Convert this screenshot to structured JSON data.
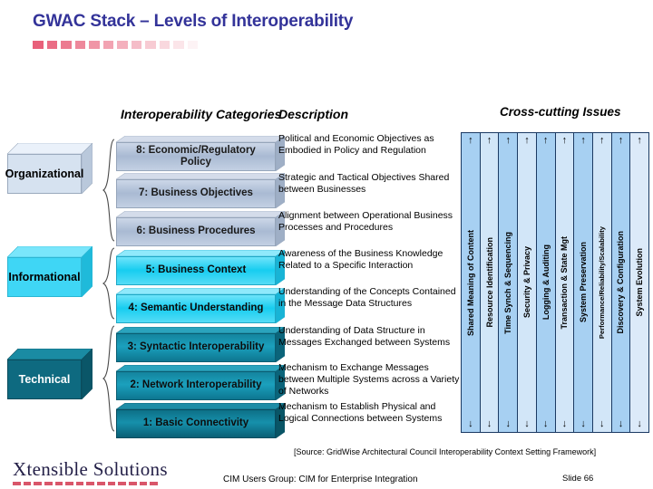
{
  "title": "GWAC Stack – Levels of Interoperability",
  "headers": {
    "categories": "Interoperability Categories",
    "description": "Description",
    "cross_cutting": "Cross-cutting Issues"
  },
  "groups": [
    {
      "label": "Organizational",
      "color": "#d6e2f0",
      "text_color": "#000000"
    },
    {
      "label": "Informational",
      "color": "#3fd6f5",
      "text_color": "#000000"
    },
    {
      "label": "Technical",
      "color": "#0e6a80",
      "text_color": "#ffffff"
    }
  ],
  "levels": [
    {
      "label": "8: Economic/Regulatory Policy",
      "description": "Political and Economic Objectives as Embodied in Policy and Regulation",
      "color": "#b8c6dc",
      "text_color": "#1a1a1a"
    },
    {
      "label": "7: Business Objectives",
      "description": "Strategic and Tactical Objectives Shared between Businesses",
      "color": "#b8c6dc",
      "text_color": "#1a1a1a"
    },
    {
      "label": "6: Business Procedures",
      "description": "Alignment between Operational Business Processes and Procedures",
      "color": "#b8c6dc",
      "text_color": "#1a1a1a"
    },
    {
      "label": "5: Business Context",
      "description": "Awareness of the Business Knowledge Related to a Specific Interaction",
      "color": "#2fd2f2",
      "text_color": "#0a0a0a"
    },
    {
      "label": "4: Semantic Understanding",
      "description": "Understanding of the Concepts Contained in the Message Data Structures",
      "color": "#2fd2f2",
      "text_color": "#0a0a0a"
    },
    {
      "label": "3: Syntactic Interoperability",
      "description": "Understanding of Data Structure in Messages Exchanged between Systems",
      "color": "#0f7f96",
      "text_color": "#0d0d0d"
    },
    {
      "label": "2: Network Interoperability",
      "description": "Mechanism to Exchange Messages between Multiple Systems across a Variety of Networks",
      "color": "#0f7f96",
      "text_color": "#0d0d0d"
    },
    {
      "label": "1: Basic Connectivity",
      "description": "Mechanism to Establish Physical and Logical Connections between Systems",
      "color": "#0a6378",
      "text_color": "#0d0d0d"
    }
  ],
  "cross_cutting_issues": [
    {
      "label": "Shared Meaning of Content",
      "color": "#a7d0f2"
    },
    {
      "label": "Resource Identification",
      "color": "#d2e6f8"
    },
    {
      "label": "Time Synch & Sequencing",
      "color": "#a7d0f2"
    },
    {
      "label": "Security & Privacy",
      "color": "#d2e6f8"
    },
    {
      "label": "Logging & Auditing",
      "color": "#a7d0f2"
    },
    {
      "label": "Transaction & State Mgt",
      "color": "#d2e6f8"
    },
    {
      "label": "System Preservation",
      "color": "#a7d0f2"
    },
    {
      "label": "Performance/Reliability/Scalability",
      "color": "#d2e6f8"
    },
    {
      "label": "Discovery & Configuration",
      "color": "#a7d0f2"
    },
    {
      "label": "System Evolution",
      "color": "#dceaf9"
    }
  ],
  "arrows": {
    "up": "↑",
    "down": "↓"
  },
  "footer": {
    "source": "[Source: GridWise Architectural Council Interoperability Context Setting Framework]",
    "center": "CIM Users Group: CIM for Enterprise Integration",
    "slide_number": "Slide 66",
    "logo_text": "Xtensible Solutions"
  },
  "theme": {
    "title_color": "#333399",
    "rule_color": "#e8607a",
    "panel_border": "#1b3a63"
  }
}
